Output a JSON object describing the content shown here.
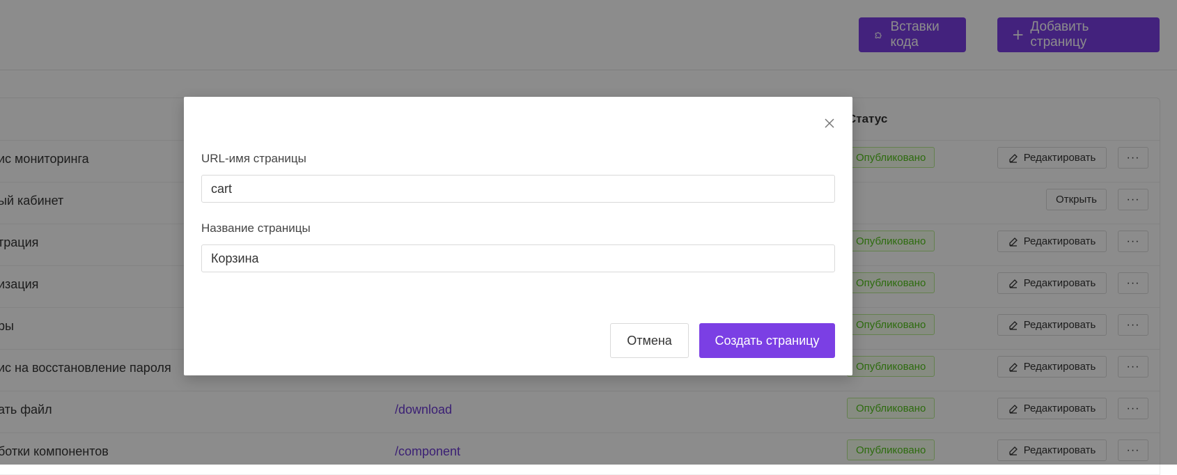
{
  "header": {
    "code_inserts_label": "Вставки кода",
    "add_page_label": "Добавить страницу"
  },
  "table": {
    "status_header": "Статус",
    "rows": [
      {
        "name": "ис мониторинга",
        "url": "",
        "status": "Опубликовано",
        "action": "Редактировать"
      },
      {
        "name": "ый кабинет",
        "url": "",
        "status": "",
        "action": "Открыть"
      },
      {
        "name": "трация",
        "url": "",
        "status": "Опубликовано",
        "action": "Редактировать"
      },
      {
        "name": "изация",
        "url": "",
        "status": "Опубликовано",
        "action": "Редактировать"
      },
      {
        "name": "ры",
        "url": "",
        "status": "Опубликовано",
        "action": "Редактировать"
      },
      {
        "name": "ис на восстановление пароля",
        "url": "",
        "status": "Опубликовано",
        "action": "Редактировать"
      },
      {
        "name": "ать файл",
        "url": "/download",
        "status": "Опубликовано",
        "action": "Редактировать"
      },
      {
        "name": "ботки компонентов",
        "url": "/component",
        "status": "Опубликовано",
        "action": "Редактировать"
      }
    ],
    "more_label": "···"
  },
  "modal": {
    "url_label": "URL-имя страницы",
    "url_value": "cart",
    "title_label": "Название страницы",
    "title_value": "Корзина",
    "cancel_label": "Отмена",
    "create_label": "Создать страницу"
  },
  "colors": {
    "accent": "#7b3fe4",
    "published_text": "#52c41a",
    "published_bg": "#f6ffed",
    "link": "#6c3bd4"
  },
  "icons": {
    "code_inserts": "puzzle-icon",
    "add_page": "plus-icon",
    "edit": "pencil-icon",
    "close": "close-icon"
  }
}
